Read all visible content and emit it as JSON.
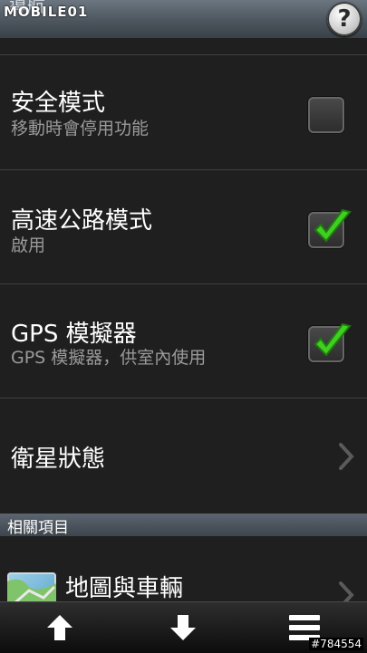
{
  "header": {
    "title": "導航",
    "watermark": "MOBILE01",
    "help_label": "?"
  },
  "settings": [
    {
      "label": "安全模式",
      "sub": "移動時會停用功能",
      "checked": false
    },
    {
      "label": "高速公路模式",
      "sub": "啟用",
      "checked": true
    },
    {
      "label": "GPS 模擬器",
      "sub": "GPS 模擬器，供室內使用",
      "checked": true
    }
  ],
  "satellite": {
    "label": "衛星狀態"
  },
  "related": {
    "header": "相關項目",
    "item_label": "地圖與車輛"
  },
  "bottom": {
    "tag": "#784554"
  },
  "colors": {
    "check": "#3fcf20",
    "section_bar": "#4a535b"
  }
}
